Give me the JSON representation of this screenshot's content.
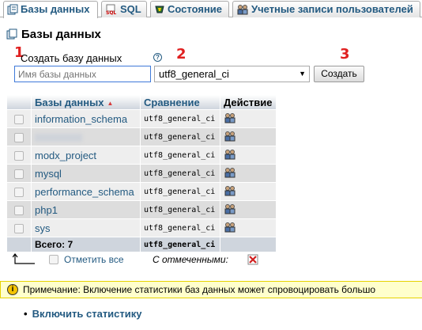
{
  "tabs": [
    {
      "label": "Базы данных",
      "icon": "databases-icon",
      "active": true
    },
    {
      "label": "SQL",
      "icon": "sql-icon",
      "active": false
    },
    {
      "label": "Состояние",
      "icon": "status-icon",
      "active": false
    },
    {
      "label": "Учетные записи пользователей",
      "icon": "users-icon",
      "active": false
    }
  ],
  "page": {
    "title": "Базы данных"
  },
  "create": {
    "label": "Создать базу данных",
    "name_placeholder": "Имя базы данных",
    "collation_value": "utf8_general_ci",
    "button_label": "Создать"
  },
  "annotations": [
    "1",
    "2",
    "3"
  ],
  "table": {
    "headers": {
      "name": "Базы данных",
      "collation": "Сравнение",
      "action": "Действие"
    },
    "rows": [
      {
        "name": "information_schema",
        "collation": "utf8_general_ci"
      },
      {
        "name": "",
        "collation": "utf8_general_ci"
      },
      {
        "name": "modx_project",
        "collation": "utf8_general_ci"
      },
      {
        "name": "mysql",
        "collation": "utf8_general_ci"
      },
      {
        "name": "performance_schema",
        "collation": "utf8_general_ci"
      },
      {
        "name": "php1",
        "collation": "utf8_general_ci"
      },
      {
        "name": "sys",
        "collation": "utf8_general_ci"
      }
    ],
    "total_label": "Всего: 7",
    "total_collation": "utf8_general_ci"
  },
  "bulk": {
    "check_all": "Отметить все",
    "with_selected": "С отмеченными:"
  },
  "notice": {
    "text": "Примечание: Включение статистики баз данных может спровоцировать большо"
  },
  "enable_stats": "Включить статистику",
  "colors": {
    "link": "#235a81",
    "annotation": "#e02020",
    "notice_bg": "#ffffcc"
  }
}
